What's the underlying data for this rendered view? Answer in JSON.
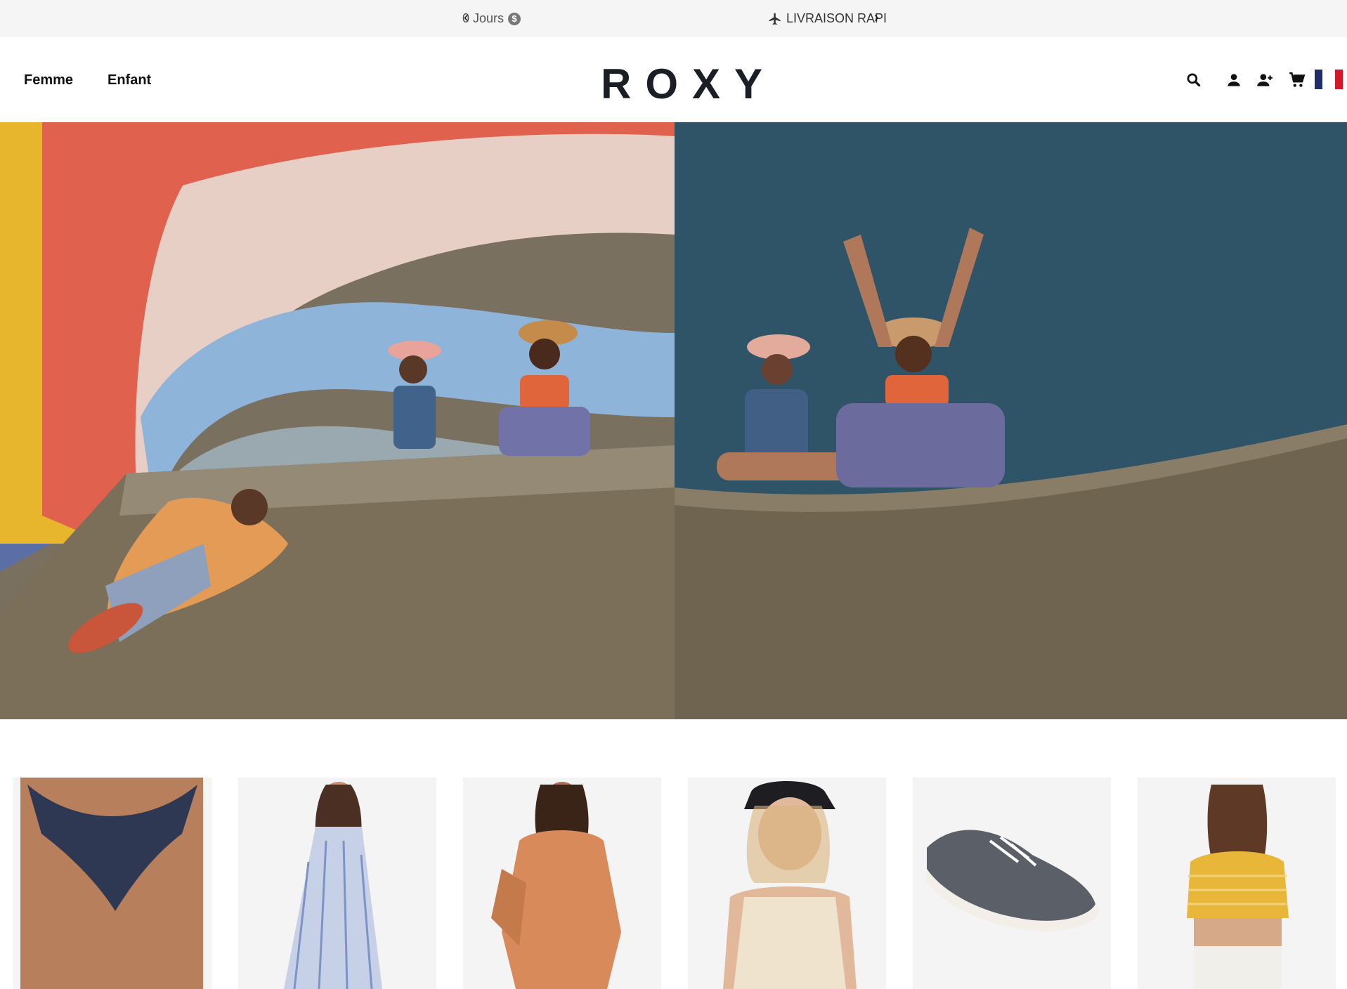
{
  "promo": {
    "left_text": "0 Jours",
    "left_badge": "$",
    "right_text": "LIVRAISON RAPI",
    "prev_arrow": "‹",
    "next_arrow": "›",
    "right_icon": "airplane-icon"
  },
  "nav": {
    "femme": "Femme",
    "enfant": "Enfant"
  },
  "logo": "ROXY",
  "header_icons": [
    "search-icon",
    "account-icon",
    "add-user-icon",
    "cart-icon",
    "france-flag-icon"
  ],
  "colors": {
    "promo_bg": "#f5f5f5",
    "brand_dark": "#1a1f26",
    "flag_blue": "#1d2e6b",
    "flag_red": "#d2192b",
    "card_bg": "#f4f4f4"
  },
  "hero": {
    "left_image": "skatepark-rainbow-wall-photo",
    "right_image": "skatepark-blue-sky-photo"
  },
  "products": [
    {
      "image": "navy-bikini-bottom"
    },
    {
      "image": "striped-sundress"
    },
    {
      "image": "orange-hoodie"
    },
    {
      "image": "cream-tank-with-cap"
    },
    {
      "image": "grey-sneaker"
    },
    {
      "image": "yellow-striped-crop-top"
    }
  ]
}
